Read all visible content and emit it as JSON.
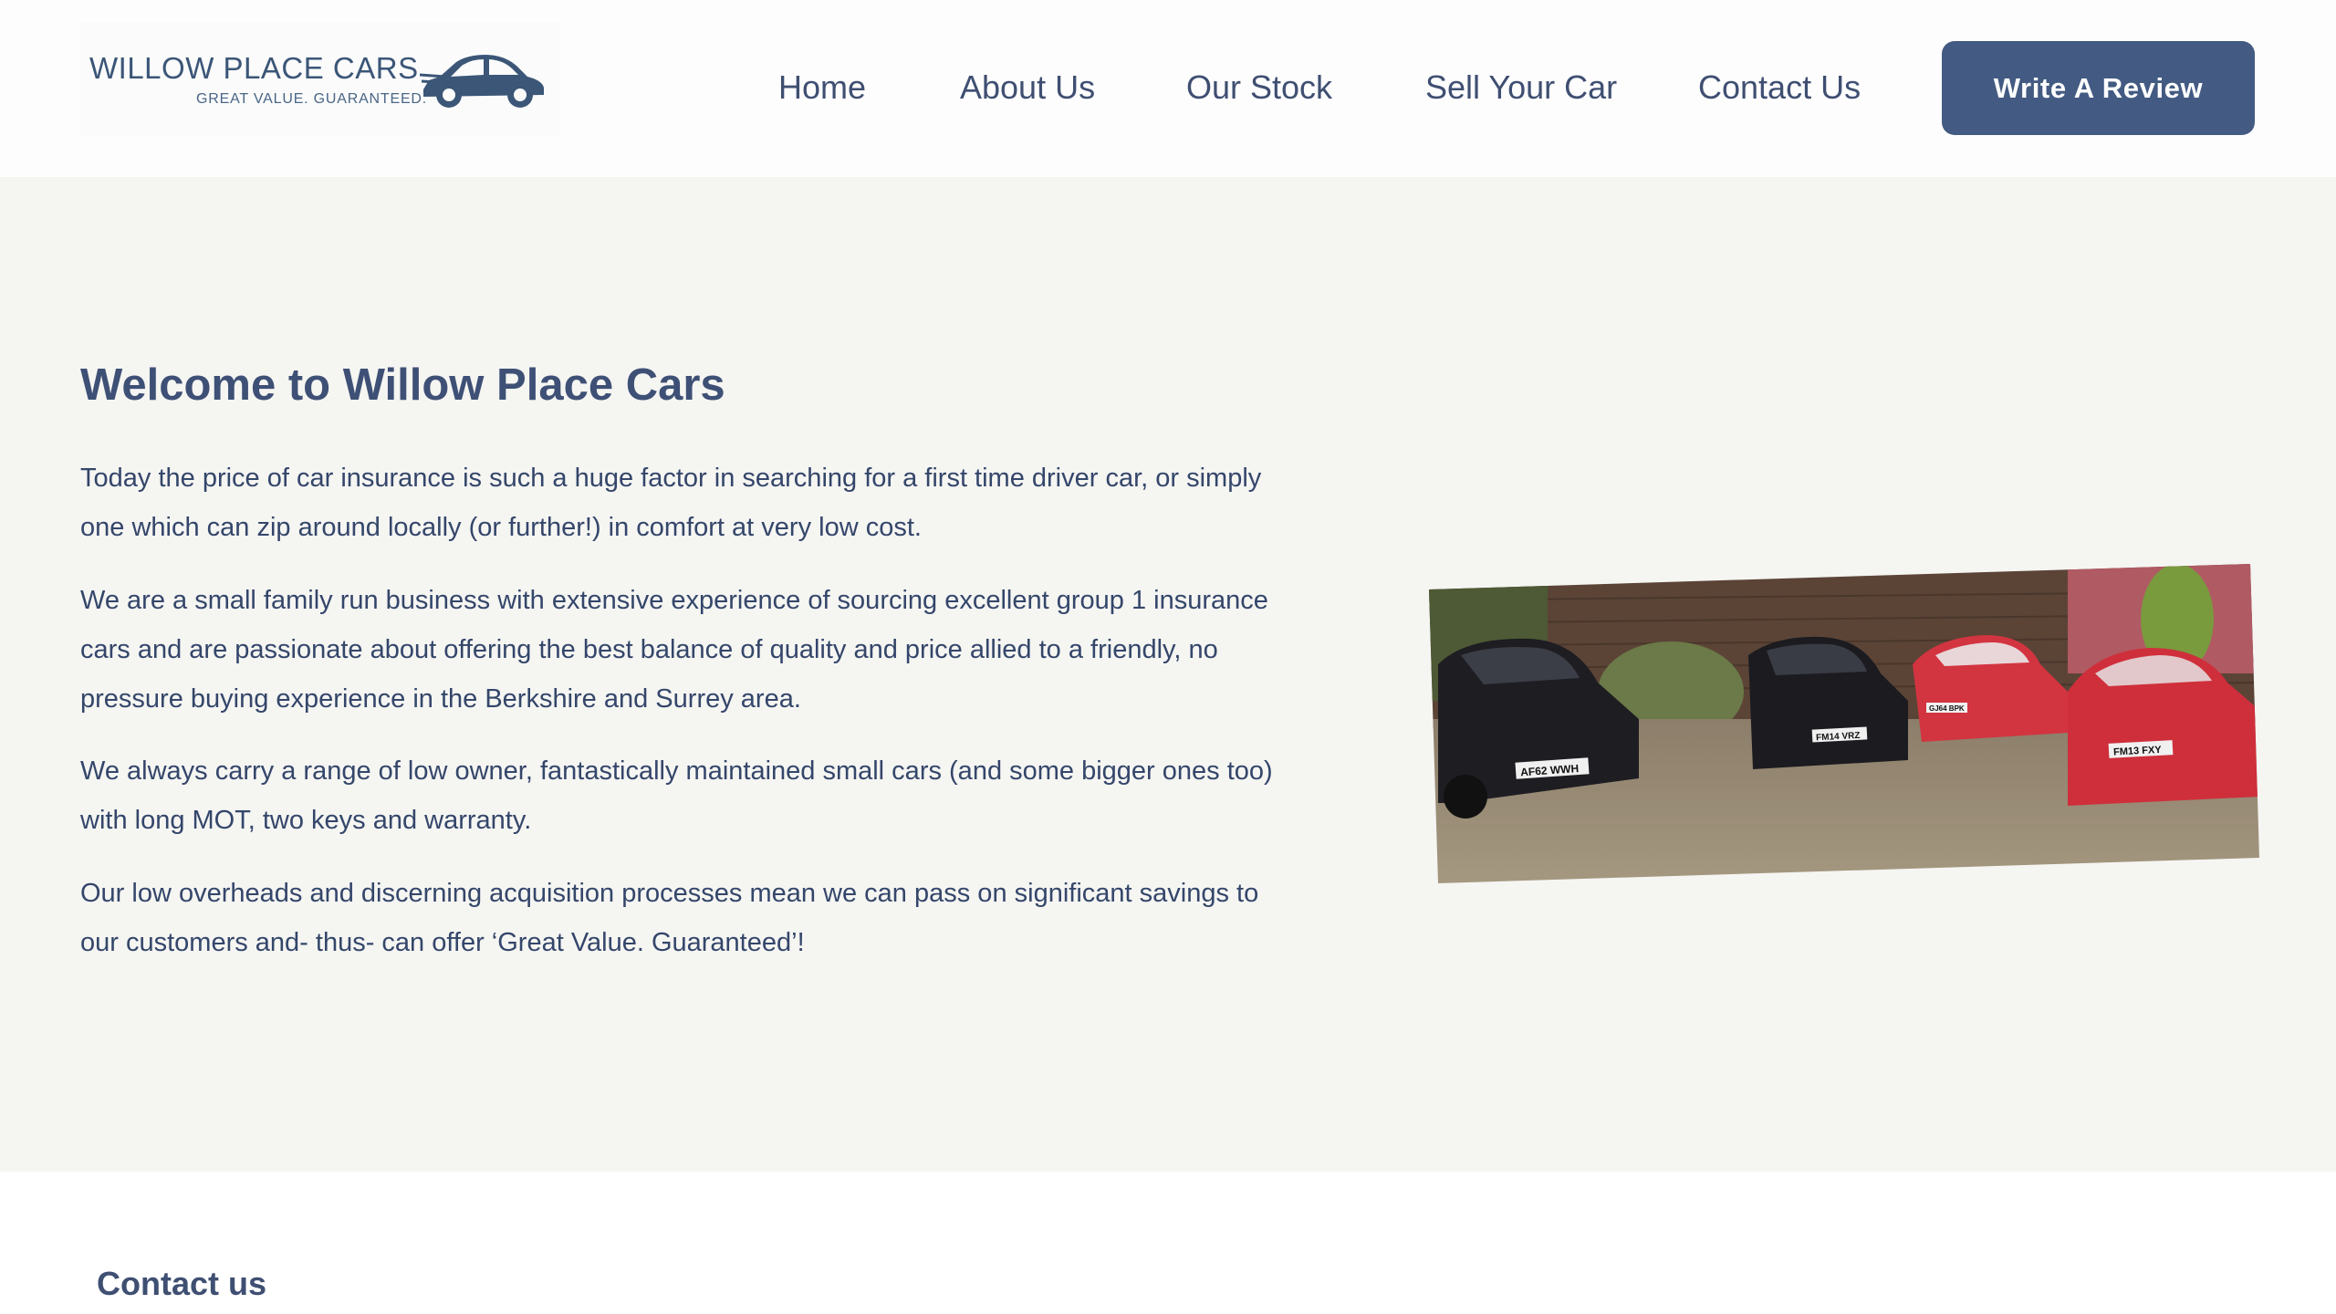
{
  "brand": {
    "name": "WILLOW PLACE CARS",
    "tagline": "GREAT VALUE. GUARANTEED.",
    "logo_icon": "car-icon",
    "color": "#3b5677"
  },
  "nav": {
    "items": [
      {
        "label": "Home"
      },
      {
        "label": "About Us"
      },
      {
        "label": "Our Stock"
      },
      {
        "label": "Sell Your Car"
      },
      {
        "label": "Contact Us"
      }
    ],
    "cta_label": "Write A Review",
    "cta_color": "#435a82"
  },
  "hero": {
    "title": "Welcome to Willow Place Cars",
    "paragraphs": [
      "Today the price of car insurance is such a huge factor in searching for a first time driver car, or simply one which can zip around locally (or further!) in comfort at very low cost.",
      "We are a small family run business with extensive experience of sourcing excellent group 1 insurance cars and are passionate about offering the best balance of quality and price allied to a friendly, no pressure buying experience in the Berkshire and Surrey area.",
      "We always carry a range of low owner, fantastically maintained small cars (and some bigger ones too) with long MOT, two keys and warranty.",
      "Our low overheads and discerning acquisition processes mean we can pass on significant savings to our customers and- thus- can offer ‘Great Value. Guaranteed’!"
    ],
    "photo": {
      "plates": [
        "AF62 WWH",
        "FM14 VRZ",
        "GJ64 BPK",
        "FM13 FXY"
      ]
    },
    "background": "#f5f5f2"
  },
  "footer": {
    "heading": "Contact us"
  }
}
